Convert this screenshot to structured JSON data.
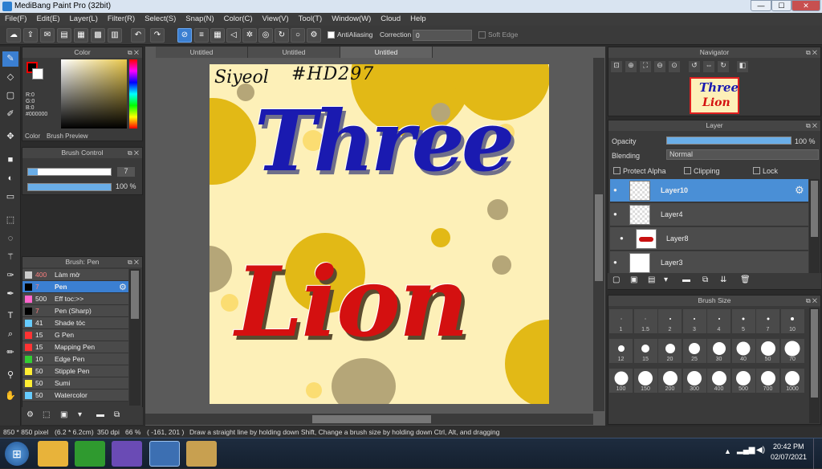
{
  "titlebar": {
    "title": "MediBang Paint Pro (32bit)",
    "min": "—",
    "max": "☐",
    "close": "✕"
  },
  "menu": [
    "File(F)",
    "Edit(E)",
    "Layer(L)",
    "Filter(R)",
    "Select(S)",
    "Snap(N)",
    "Color(C)",
    "View(V)",
    "Tool(T)",
    "Window(W)",
    "Cloud",
    "Help"
  ],
  "toolbar": {
    "antialiasing": "AntiAliasing",
    "correction_label": "Correction",
    "correction_value": "0",
    "protect_edge": "Soft Edge"
  },
  "color_panel": {
    "title": "Color",
    "r": "R:0",
    "g": "G:0",
    "b": "B:0",
    "hex": "#000000",
    "tab_color": "Color",
    "tab_preview": "Brush Preview"
  },
  "brush_control": {
    "title": "Brush Control",
    "size": "7",
    "opacity": "100 %"
  },
  "brush_list": {
    "title": "Brush: Pen",
    "items": [
      {
        "size": "400",
        "name": "Làm mờ",
        "color": "#cccccc"
      },
      {
        "size": "7",
        "name": "Pen",
        "color": "#000000"
      },
      {
        "size": "500",
        "name": "Eff toc:>>",
        "color": "#ff66cc"
      },
      {
        "size": "7",
        "name": "Pen (Sharp)",
        "color": "#000000"
      },
      {
        "size": "41",
        "name": "Shade tóc",
        "color": "#66ccff"
      },
      {
        "size": "15",
        "name": "G Pen",
        "color": "#ff3333"
      },
      {
        "size": "15",
        "name": "Mapping Pen",
        "color": "#ff3333"
      },
      {
        "size": "10",
        "name": "Edge Pen",
        "color": "#33cc33"
      },
      {
        "size": "50",
        "name": "Stipple Pen",
        "color": "#ffee33"
      },
      {
        "size": "50",
        "name": "Sumi",
        "color": "#ffee33"
      },
      {
        "size": "50",
        "name": "Watercolor",
        "color": "#66ccff"
      }
    ]
  },
  "tabs": [
    "Untitled",
    "Untitled",
    "Untitled"
  ],
  "canvas": {
    "signature": "Siyeol",
    "tag": "#HD297",
    "word1": "Three",
    "word2": "Lion"
  },
  "navigator": {
    "title": "Navigator"
  },
  "layer_panel": {
    "title": "Layer",
    "opacity_label": "Opacity",
    "opacity_value": "100 %",
    "blending_label": "Blending",
    "blending_value": "Normal",
    "protect_alpha": "Protect Alpha",
    "clipping": "Clipping",
    "lock": "Lock",
    "layers": [
      "Layer10",
      "Layer4",
      "Layer8",
      "Layer3"
    ]
  },
  "brush_size": {
    "title": "Brush Size",
    "sizes": [
      "1",
      "1.5",
      "2",
      "3",
      "4",
      "5",
      "7",
      "10",
      "12",
      "15",
      "20",
      "25",
      "30",
      "40",
      "50",
      "70",
      "100",
      "150",
      "200",
      "300",
      "400",
      "500",
      "700",
      "1000"
    ]
  },
  "status": {
    "dimensions": "850 * 850 pixel",
    "cm": "(6.2 * 6.2cm)",
    "dpi": "350 dpi",
    "zoom": "66 %",
    "coords": "( -161, 201 )",
    "hint": "Draw a straight line by holding down Shift, Change a brush size by holding down Ctrl, Alt, and dragging"
  },
  "taskbar": {
    "time": "20:42 PM",
    "date": "02/07/2021"
  }
}
